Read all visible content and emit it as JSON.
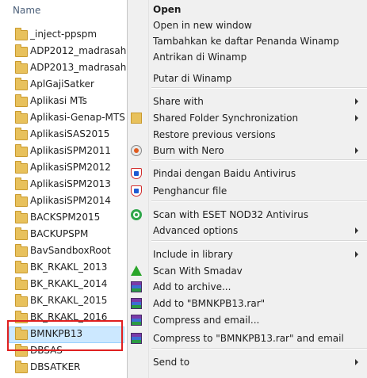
{
  "explorer": {
    "header": "Name",
    "items": [
      {
        "name": "_inject-ppspm"
      },
      {
        "name": "ADP2012_madrasah"
      },
      {
        "name": "ADP2013_madrasah"
      },
      {
        "name": "AplGajiSatker"
      },
      {
        "name": "Aplikasi MTs"
      },
      {
        "name": "Aplikasi-Genap-MTS"
      },
      {
        "name": "AplikasiSAS2015"
      },
      {
        "name": "AplikasiSPM2011"
      },
      {
        "name": "AplikasiSPM2012"
      },
      {
        "name": "AplikasiSPM2013"
      },
      {
        "name": "AplikasiSPM2014"
      },
      {
        "name": "BACKSPM2015"
      },
      {
        "name": "BACKUPSPM"
      },
      {
        "name": "BavSandboxRoot"
      },
      {
        "name": "BK_RKAKL_2013"
      },
      {
        "name": "BK_RKAKL_2014"
      },
      {
        "name": "BK_RKAKL_2015"
      },
      {
        "name": "BK_RKAKL_2016"
      },
      {
        "name": "BMNKPB13"
      },
      {
        "name": "DBSAS"
      },
      {
        "name": "DBSATKER"
      }
    ],
    "selected_index": 18
  },
  "context_menu": {
    "items": [
      {
        "label": "Open",
        "bold": true
      },
      {
        "label": "Open in new window"
      },
      {
        "label": "Tambahkan ke daftar Penanda Winamp"
      },
      {
        "label": "Antrikan di Winamp"
      },
      {
        "label": "Putar di Winamp"
      },
      {
        "label": "Share with",
        "submenu": true
      },
      {
        "label": "Shared Folder Synchronization",
        "submenu": true,
        "icon": "shared-folder-icon"
      },
      {
        "label": "Restore previous versions"
      },
      {
        "label": "Burn with Nero",
        "submenu": true,
        "icon": "nero-icon"
      },
      {
        "label": "Pindai dengan Baidu Antivirus",
        "icon": "baidu-shield-icon"
      },
      {
        "label": "Penghancur file",
        "icon": "baidu-shield-icon"
      },
      {
        "label": "Scan with ESET NOD32 Antivirus",
        "icon": "eset-icon"
      },
      {
        "label": "Advanced options",
        "submenu": true
      },
      {
        "label": "Include in library",
        "submenu": true
      },
      {
        "label": "Scan With Smadav",
        "icon": "smadav-icon"
      },
      {
        "label": "Add to archive...",
        "icon": "winrar-icon"
      },
      {
        "label": "Add to \"BMNKPB13.rar\"",
        "icon": "winrar-icon"
      },
      {
        "label": "Compress and email...",
        "icon": "winrar-icon"
      },
      {
        "label": "Compress to \"BMNKPB13.rar\" and email",
        "icon": "winrar-icon"
      },
      {
        "label": "Send to",
        "submenu": true
      }
    ]
  },
  "colors": {
    "selection_bg": "#cce8ff",
    "highlight_border": "#e02020",
    "menu_bg": "#f0f0f0"
  }
}
